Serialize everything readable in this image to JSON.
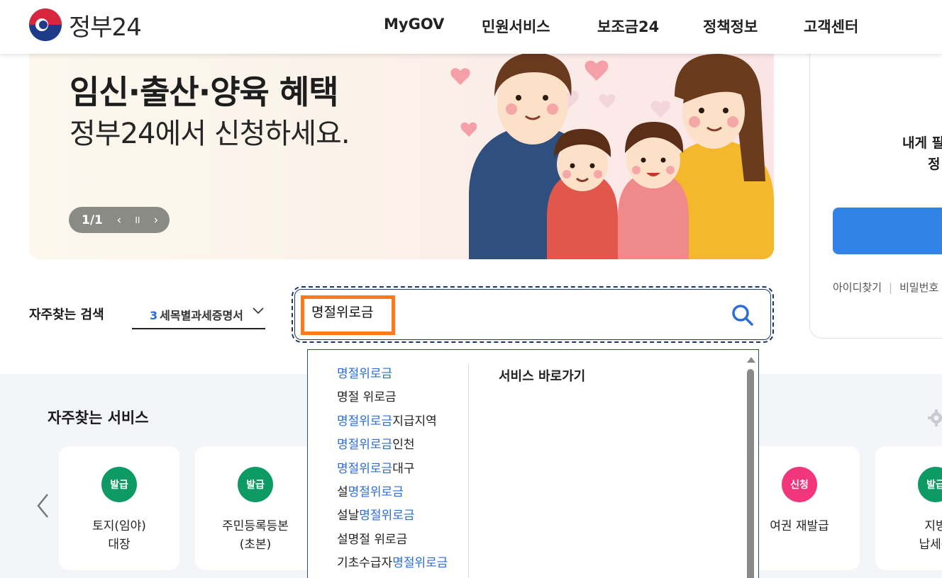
{
  "header": {
    "logo_text": "정부24",
    "nav": [
      "MyGOV",
      "민원서비스",
      "보조금24",
      "정책정보",
      "고객센터"
    ]
  },
  "banner": {
    "title": "임신·출산·양육 혜택",
    "subtitle": "정부24에서 신청하세요.",
    "counter": "1/1",
    "prev_icon": "‹",
    "pause_icon": "II",
    "next_icon": "›"
  },
  "login_panel": {
    "line1": "내게 필",
    "line2": "정",
    "links": [
      "아이디찾기",
      "비밀번호"
    ]
  },
  "search": {
    "frequent_label": "자주찾는 검색",
    "select_rank": "3",
    "select_text": "세목별과세증명서",
    "query": "명절위로금",
    "suggestions": [
      {
        "pre": "",
        "hl": "명절위로금",
        "post": ""
      },
      {
        "pre": "명절 위로금",
        "hl": "",
        "post": ""
      },
      {
        "pre": "",
        "hl": "명절위로금",
        "post": "지급지역"
      },
      {
        "pre": "",
        "hl": "명절위로금",
        "post": "인천"
      },
      {
        "pre": "",
        "hl": "명절위로금",
        "post": "대구"
      },
      {
        "pre": "설",
        "hl": "명절위로금",
        "post": ""
      },
      {
        "pre": "설날",
        "hl": "명절위로금",
        "post": ""
      },
      {
        "pre": "설명절 위로금",
        "hl": "",
        "post": ""
      },
      {
        "pre": "기초수급자",
        "hl": "명절위로금",
        "post": ""
      }
    ],
    "shortcut_title": "서비스 바로가기"
  },
  "services": {
    "title": "자주찾는 서비스",
    "cards": [
      {
        "badge": "발급",
        "label1": "토지(임야)",
        "label2": "대장",
        "color": "#0e9a63"
      },
      {
        "badge": "발급",
        "label1": "주민등록등본",
        "label2": "(초본)",
        "color": "#0e9a63"
      },
      {
        "badge": "신청",
        "label1": "여권 재발급",
        "label2": "",
        "color": "#f2367d"
      },
      {
        "badge": "발급",
        "label1": "지방",
        "label2": "납세증",
        "color": "#0e9a63"
      }
    ]
  },
  "colors": {
    "accent_blue": "#2a6dd6",
    "highlight_orange": "#ff7a1a",
    "issue_green": "#0e9a63",
    "apply_pink": "#f2367d"
  }
}
